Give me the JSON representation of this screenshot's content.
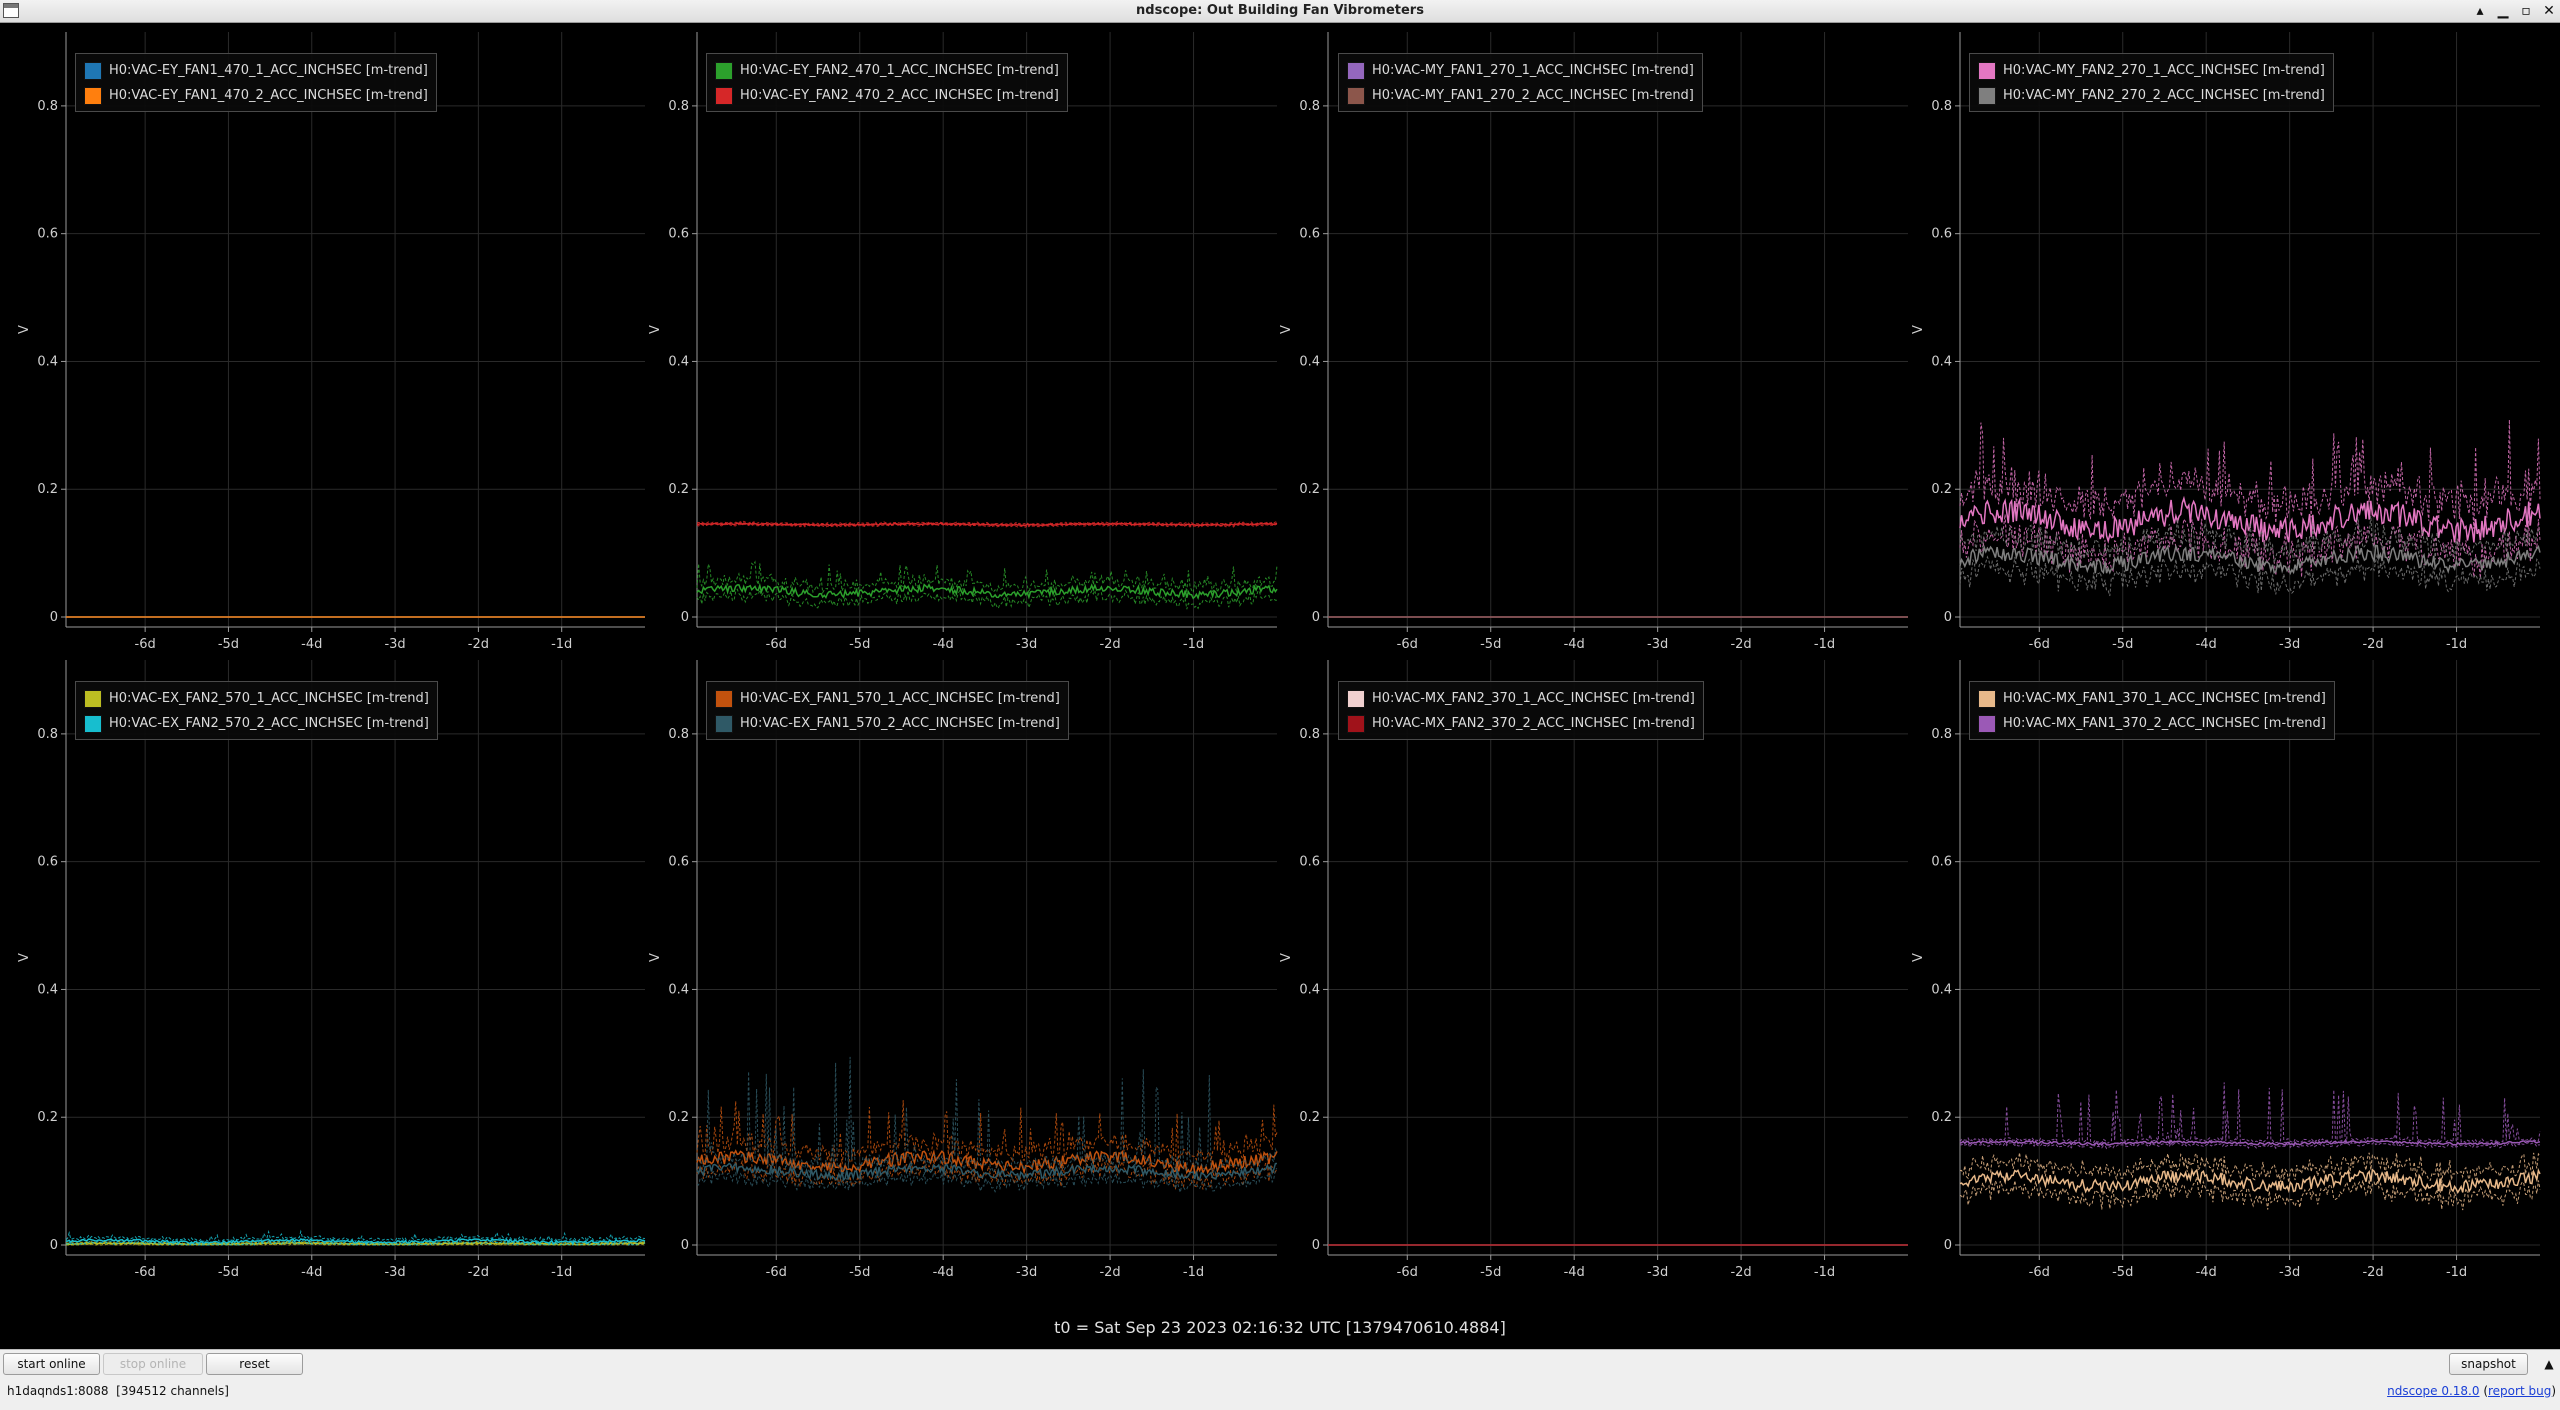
{
  "window": {
    "title": "ndscope: Out Building Fan Vibrometers",
    "controls": [
      "▴",
      "▁",
      "▫",
      "✕"
    ]
  },
  "plots": [
    {
      "legend": [
        {
          "label": "H0:VAC-EY_FAN1_470_1_ACC_INCHSEC [m-trend]",
          "color": "#1f77b4"
        },
        {
          "label": "H0:VAC-EY_FAN1_470_2_ACC_INCHSEC [m-trend]",
          "color": "#ff7f0e"
        }
      ]
    },
    {
      "legend": [
        {
          "label": "H0:VAC-EY_FAN2_470_1_ACC_INCHSEC [m-trend]",
          "color": "#2ca02c"
        },
        {
          "label": "H0:VAC-EY_FAN2_470_2_ACC_INCHSEC [m-trend]",
          "color": "#d62728"
        }
      ]
    },
    {
      "legend": [
        {
          "label": "H0:VAC-MY_FAN1_270_1_ACC_INCHSEC [m-trend]",
          "color": "#9467bd"
        },
        {
          "label": "H0:VAC-MY_FAN1_270_2_ACC_INCHSEC [m-trend]",
          "color": "#8c564b"
        }
      ]
    },
    {
      "legend": [
        {
          "label": "H0:VAC-MY_FAN2_270_1_ACC_INCHSEC [m-trend]",
          "color": "#e377c2"
        },
        {
          "label": "H0:VAC-MY_FAN2_270_2_ACC_INCHSEC [m-trend]",
          "color": "#7f7f7f"
        }
      ]
    },
    {
      "legend": [
        {
          "label": "H0:VAC-EX_FAN2_570_1_ACC_INCHSEC [m-trend]",
          "color": "#bcbd22"
        },
        {
          "label": "H0:VAC-EX_FAN2_570_2_ACC_INCHSEC [m-trend]",
          "color": "#17becf"
        }
      ]
    },
    {
      "legend": [
        {
          "label": "H0:VAC-EX_FAN1_570_1_ACC_INCHSEC [m-trend]",
          "color": "#c2520e"
        },
        {
          "label": "H0:VAC-EX_FAN1_570_2_ACC_INCHSEC [m-trend]",
          "color": "#2f5966"
        }
      ]
    },
    {
      "legend": [
        {
          "label": "H0:VAC-MX_FAN2_370_1_ACC_INCHSEC [m-trend]",
          "color": "#f0d0cf"
        },
        {
          "label": "H0:VAC-MX_FAN2_370_2_ACC_INCHSEC [m-trend]",
          "color": "#a0121a"
        }
      ]
    },
    {
      "legend": [
        {
          "label": "H0:VAC-MX_FAN1_370_1_ACC_INCHSEC [m-trend]",
          "color": "#e8b98a"
        },
        {
          "label": "H0:VAC-MX_FAN1_370_2_ACC_INCHSEC [m-trend]",
          "color": "#9b59b6"
        }
      ]
    }
  ],
  "chart_data": {
    "type": "line",
    "layout_grid": "2x4",
    "ylabel": "V",
    "ylim": [
      0,
      0.9
    ],
    "y_ticks": [
      "0",
      "0.2",
      "0.4",
      "0.6",
      "0.8"
    ],
    "y_tick_values": [
      0,
      0.2,
      0.4,
      0.6,
      0.8
    ],
    "x_ticks": [
      "-6d",
      "-5d",
      "-4d",
      "-3d",
      "-2d",
      "-1d"
    ],
    "x_tick_values": [
      -6,
      -5,
      -4,
      -3,
      -2,
      -1
    ],
    "xlim_days": [
      -6.95,
      0
    ],
    "grid": true,
    "legend_position": "top-left",
    "panels": [
      {
        "series": [
          {
            "name": "H0:VAC-EY_FAN1_470_1_ACC_INCHSEC [m-trend]",
            "color": "#1f77b4",
            "level": 0.0,
            "noise": 0.0,
            "spike": 0
          },
          {
            "name": "H0:VAC-EY_FAN1_470_2_ACC_INCHSEC [m-trend]",
            "color": "#ff7f0e",
            "level": 0.0,
            "noise": 0.0,
            "spike": 0
          }
        ]
      },
      {
        "series": [
          {
            "name": "H0:VAC-EY_FAN2_470_1_ACC_INCHSEC [m-trend]",
            "color": "#2ca02c",
            "level": 0.04,
            "noise": 0.012,
            "spike": 0.03
          },
          {
            "name": "H0:VAC-EY_FAN2_470_2_ACC_INCHSEC [m-trend]",
            "color": "#d62728",
            "level": 0.145,
            "noise": 0.002,
            "spike": 0
          }
        ]
      },
      {
        "series": [
          {
            "name": "H0:VAC-MY_FAN1_270_1_ACC_INCHSEC [m-trend]",
            "color": "#9467bd",
            "level": 0.0,
            "noise": 0.0,
            "spike": 0
          },
          {
            "name": "H0:VAC-MY_FAN1_270_2_ACC_INCHSEC [m-trend]",
            "color": "#8c564b",
            "level": 0.0,
            "noise": 0.0,
            "spike": 0
          }
        ]
      },
      {
        "series": [
          {
            "name": "H0:VAC-MY_FAN2_270_1_ACC_INCHSEC [m-trend]",
            "color": "#e377c2",
            "level": 0.15,
            "noise": 0.04,
            "spike": 0.1
          },
          {
            "name": "H0:VAC-MY_FAN2_270_2_ACC_INCHSEC [m-trend]",
            "color": "#7f7f7f",
            "level": 0.09,
            "noise": 0.025,
            "spike": 0.03
          }
        ]
      },
      {
        "series": [
          {
            "name": "H0:VAC-EX_FAN2_570_1_ACC_INCHSEC [m-trend]",
            "color": "#bcbd22",
            "level": 0.002,
            "noise": 0.002,
            "spike": 0
          },
          {
            "name": "H0:VAC-EX_FAN2_570_2_ACC_INCHSEC [m-trend]",
            "color": "#17becf",
            "level": 0.006,
            "noise": 0.004,
            "spike": 0.008
          }
        ]
      },
      {
        "series": [
          {
            "name": "H0:VAC-EX_FAN1_570_1_ACC_INCHSEC [m-trend]",
            "color": "#c2520e",
            "level": 0.13,
            "noise": 0.02,
            "spike": 0.06
          },
          {
            "name": "H0:VAC-EX_FAN1_570_2_ACC_INCHSEC [m-trend]",
            "color": "#2f5966",
            "level": 0.115,
            "noise": 0.015,
            "spike": 0.18
          }
        ]
      },
      {
        "series": [
          {
            "name": "H0:VAC-MX_FAN2_370_1_ACC_INCHSEC [m-trend]",
            "color": "#f0d0cf",
            "level": 0.0,
            "noise": 0.0,
            "spike": 0
          },
          {
            "name": "H0:VAC-MX_FAN2_370_2_ACC_INCHSEC [m-trend]",
            "color": "#a0121a",
            "level": 0.0,
            "noise": 0.0,
            "spike": 0
          }
        ]
      },
      {
        "series": [
          {
            "name": "H0:VAC-MX_FAN1_370_1_ACC_INCHSEC [m-trend]",
            "color": "#e8b98a",
            "level": 0.1,
            "noise": 0.02,
            "spike": 0.01
          },
          {
            "name": "H0:VAC-MX_FAN1_370_2_ACC_INCHSEC [m-trend]",
            "color": "#9b59b6",
            "level": 0.16,
            "noise": 0.004,
            "spike": 0.09
          }
        ]
      }
    ]
  },
  "t0_label": "t0 = Sat Sep 23 2023 02:16:32 UTC [1379470610.4884]",
  "toolbar": {
    "start_online": "start online",
    "stop_online": "stop online",
    "reset": "reset",
    "snapshot": "snapshot",
    "expand": "▲"
  },
  "status": {
    "server": "h1daqnds1:8088",
    "channels": "[394512 channels]",
    "version": "ndscope 0.18.0",
    "report_bug": "report bug"
  }
}
